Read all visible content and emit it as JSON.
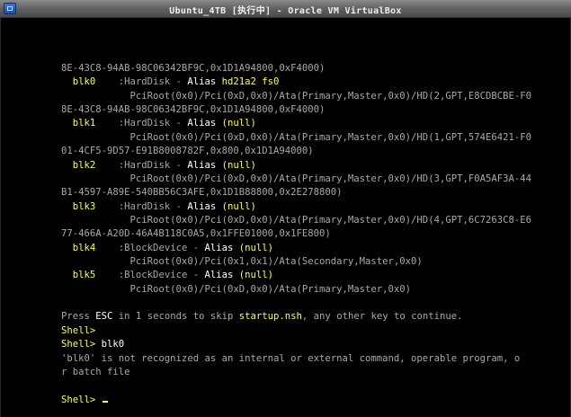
{
  "window": {
    "title": "Ubuntu_4TB [执行中] - Oracle VM VirtualBox"
  },
  "console": {
    "lines": [
      {
        "id": "map-path-blk-prev-tail",
        "segs": [
          {
            "t": "8E-43C8-94AB-98C06342BF9C,0x1D1A94800,0xF4000)",
            "c": "g"
          }
        ]
      },
      {
        "id": "blk0-row",
        "segs": [
          {
            "t": "  blk0",
            "c": "y"
          },
          {
            "t": "    :HardDisk - ",
            "c": "g"
          },
          {
            "t": "Alias ",
            "c": "w"
          },
          {
            "t": "hd21a2 fs0",
            "c": "y"
          }
        ]
      },
      {
        "id": "blk0-path-1",
        "segs": [
          {
            "t": "            PciRoot(0x0)/Pci(0xD,0x0)/Ata(Primary,Master,0x0)/HD(2,GPT,E8CDBCBE-F0",
            "c": "g"
          }
        ]
      },
      {
        "id": "blk0-path-2",
        "segs": [
          {
            "t": "8E-43C8-94AB-98C06342BF9C,0x1D1A94800,0xF4000)",
            "c": "g"
          }
        ]
      },
      {
        "id": "blk1-row",
        "segs": [
          {
            "t": "  blk1",
            "c": "y"
          },
          {
            "t": "    :HardDisk - ",
            "c": "g"
          },
          {
            "t": "Alias ",
            "c": "w"
          },
          {
            "t": "(null)",
            "c": "y"
          }
        ]
      },
      {
        "id": "blk1-path-1",
        "segs": [
          {
            "t": "            PciRoot(0x0)/Pci(0xD,0x0)/Ata(Primary,Master,0x0)/HD(1,GPT,574E6421-F0",
            "c": "g"
          }
        ]
      },
      {
        "id": "blk1-path-2",
        "segs": [
          {
            "t": "01-4CF5-9D57-E91B8008782F,0x800,0x1D1A94000)",
            "c": "g"
          }
        ]
      },
      {
        "id": "blk2-row",
        "segs": [
          {
            "t": "  blk2",
            "c": "y"
          },
          {
            "t": "    :HardDisk - ",
            "c": "g"
          },
          {
            "t": "Alias ",
            "c": "w"
          },
          {
            "t": "(null)",
            "c": "y"
          }
        ]
      },
      {
        "id": "blk2-path-1",
        "segs": [
          {
            "t": "            PciRoot(0x0)/Pci(0xD,0x0)/Ata(Primary,Master,0x0)/HD(3,GPT,F0A5AF3A-44",
            "c": "g"
          }
        ]
      },
      {
        "id": "blk2-path-2",
        "segs": [
          {
            "t": "B1-4597-A89E-540BB56C3AFE,0x1D1B88800,0x2E278800)",
            "c": "g"
          }
        ]
      },
      {
        "id": "blk3-row",
        "segs": [
          {
            "t": "  blk3",
            "c": "y"
          },
          {
            "t": "    :HardDisk - ",
            "c": "g"
          },
          {
            "t": "Alias ",
            "c": "w"
          },
          {
            "t": "(null)",
            "c": "y"
          }
        ]
      },
      {
        "id": "blk3-path-1",
        "segs": [
          {
            "t": "            PciRoot(0x0)/Pci(0xD,0x0)/Ata(Primary,Master,0x0)/HD(4,GPT,6C7263C8-E6",
            "c": "g"
          }
        ]
      },
      {
        "id": "blk3-path-2",
        "segs": [
          {
            "t": "77-466A-A20D-46A4B118C0A5,0x1FFE01000,0x1FE800)",
            "c": "g"
          }
        ]
      },
      {
        "id": "blk4-row",
        "segs": [
          {
            "t": "  blk4",
            "c": "y"
          },
          {
            "t": "    :BlockDevice - ",
            "c": "g"
          },
          {
            "t": "Alias ",
            "c": "w"
          },
          {
            "t": "(null)",
            "c": "y"
          }
        ]
      },
      {
        "id": "blk4-path-1",
        "segs": [
          {
            "t": "            PciRoot(0x0)/Pci(0x1,0x1)/Ata(Secondary,Master,0x0)",
            "c": "g"
          }
        ]
      },
      {
        "id": "blk5-row",
        "segs": [
          {
            "t": "  blk5",
            "c": "y"
          },
          {
            "t": "    :BlockDevice - ",
            "c": "g"
          },
          {
            "t": "Alias ",
            "c": "w"
          },
          {
            "t": "(null)",
            "c": "y"
          }
        ]
      },
      {
        "id": "blk5-path-1",
        "segs": [
          {
            "t": "            PciRoot(0x0)/Pci(0xD,0x0)/Ata(Primary,Master,0x0)",
            "c": "g"
          }
        ]
      },
      {
        "id": "blank-1",
        "segs": []
      },
      {
        "id": "esc-prompt",
        "segs": [
          {
            "t": "Press ",
            "c": "g"
          },
          {
            "t": "ESC",
            "c": "w"
          },
          {
            "t": " in 1 seconds to skip ",
            "c": "g"
          },
          {
            "t": "startup.nsh",
            "c": "y"
          },
          {
            "t": ", any other key to continue.",
            "c": "g"
          }
        ]
      },
      {
        "id": "shell-prompt-1",
        "segs": [
          {
            "t": "Shell>",
            "c": "y"
          }
        ]
      },
      {
        "id": "shell-command",
        "segs": [
          {
            "t": "Shell>",
            "c": "y"
          },
          {
            "t": " blk0",
            "c": "w"
          }
        ]
      },
      {
        "id": "error-line-1",
        "segs": [
          {
            "t": "'blk0' is not recognized as an internal or external command, operable program, o",
            "c": "g"
          }
        ]
      },
      {
        "id": "error-line-2",
        "segs": [
          {
            "t": "r batch file",
            "c": "g"
          }
        ]
      },
      {
        "id": "blank-2",
        "segs": []
      },
      {
        "id": "shell-prompt-active",
        "segs": [
          {
            "t": "Shell>",
            "c": "y"
          },
          {
            "t": " ",
            "c": "w"
          }
        ],
        "cursor": true
      }
    ]
  },
  "colors": {
    "gray": "#a8a8a8",
    "yellow": "#ffff55",
    "white": "#ffffff",
    "background": "#000000"
  }
}
